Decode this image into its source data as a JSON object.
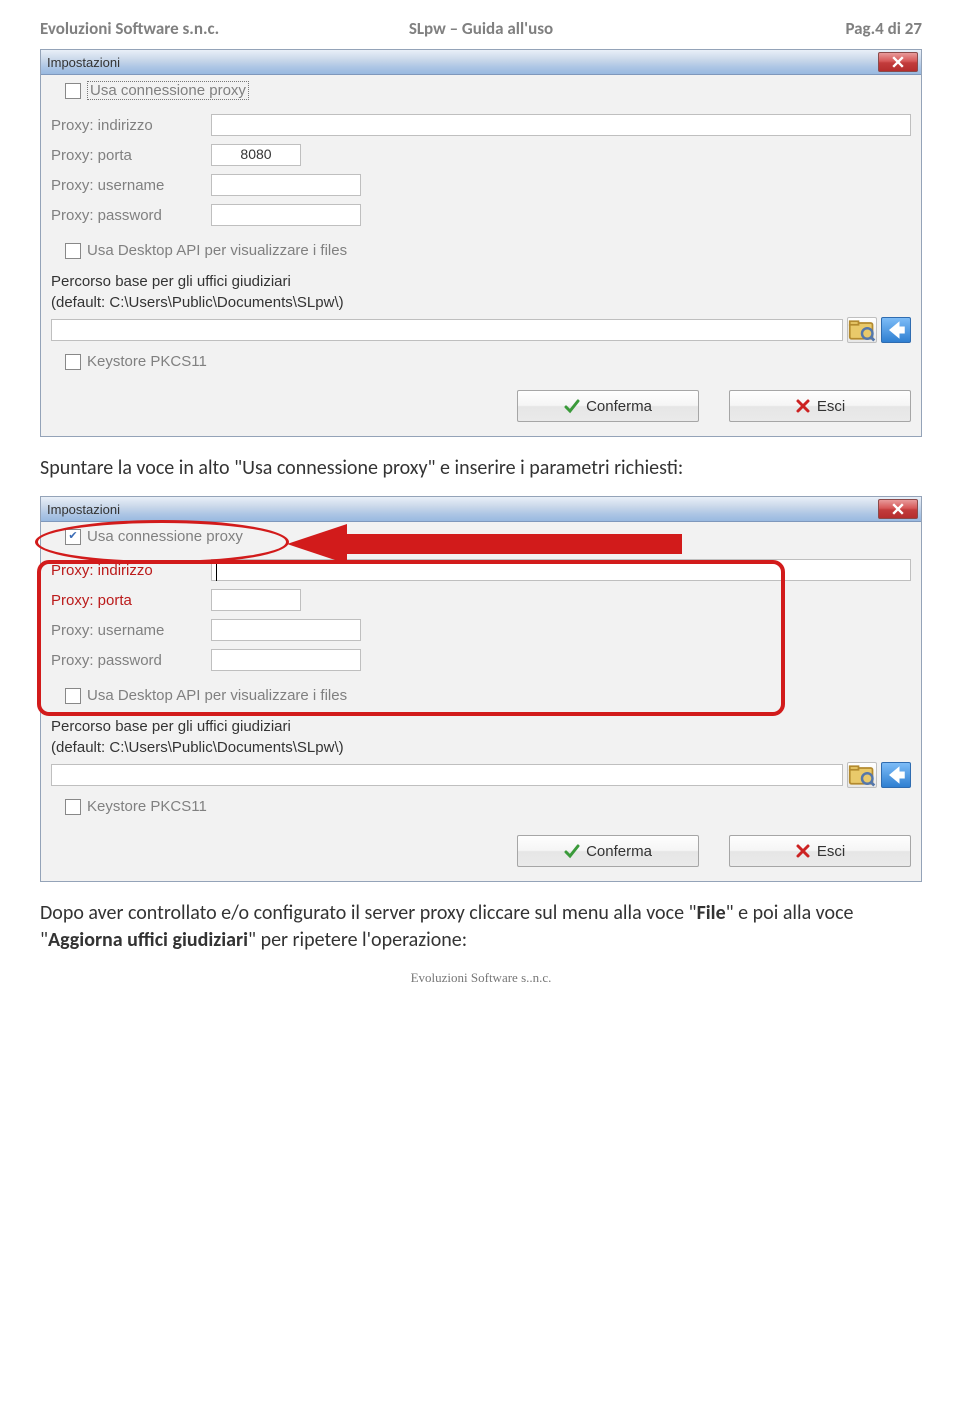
{
  "header": {
    "company": "Evoluzioni Software s.n.c.",
    "title": "SLpw – Guida all'uso",
    "page": "Pag.4 di 27"
  },
  "dialog1": {
    "title": "Impostazioni",
    "use_proxy": {
      "label": "Usa connessione proxy",
      "checked": false
    },
    "proxy_addr": {
      "label": "Proxy: indirizzo",
      "value": ""
    },
    "proxy_port": {
      "label": "Proxy: porta",
      "value": "8080"
    },
    "proxy_user": {
      "label": "Proxy: username",
      "value": ""
    },
    "proxy_pass": {
      "label": "Proxy: password",
      "value": ""
    },
    "desktop_api": {
      "label": "Usa Desktop API per visualizzare i files",
      "checked": false
    },
    "path_text_l1": "Percorso base per gli uffici giudiziari",
    "path_text_l2": "(default: C:\\Users\\Public\\Documents\\SLpw\\)",
    "path_value": "",
    "pkcs": {
      "label": "Keystore PKCS11",
      "checked": false
    },
    "btn_confirm": "Conferma",
    "btn_exit": "Esci"
  },
  "para1": "Spuntare la voce in alto \"Usa connessione proxy\" e inserire i parametri richiesti:",
  "dialog2": {
    "title": "Impostazioni",
    "use_proxy": {
      "label": "Usa connessione proxy",
      "checked": true
    },
    "proxy_addr": {
      "label": "Proxy: indirizzo",
      "value": ""
    },
    "proxy_port": {
      "label": "Proxy: porta",
      "value": ""
    },
    "proxy_user": {
      "label": "Proxy: username",
      "value": ""
    },
    "proxy_pass": {
      "label": "Proxy: password",
      "value": ""
    },
    "desktop_api": {
      "label": "Usa Desktop API per visualizzare i files",
      "checked": false
    },
    "path_text_l1": "Percorso base per gli uffici giudiziari",
    "path_text_l2": "(default: C:\\Users\\Public\\Documents\\SLpw\\)",
    "path_value": "",
    "pkcs": {
      "label": "Keystore PKCS11",
      "checked": false
    },
    "btn_confirm": "Conferma",
    "btn_exit": "Esci"
  },
  "para2_pre": "Dopo aver controllato e/o configurato il server proxy cliccare sul menu alla voce \"",
  "para2_b1": "File",
  "para2_mid": "\" e poi alla voce \"",
  "para2_b2": "Aggiorna uffici giudiziari",
  "para2_post": "\" per ripetere l'operazione:",
  "footer": "Evoluzioni Software s..n.c."
}
